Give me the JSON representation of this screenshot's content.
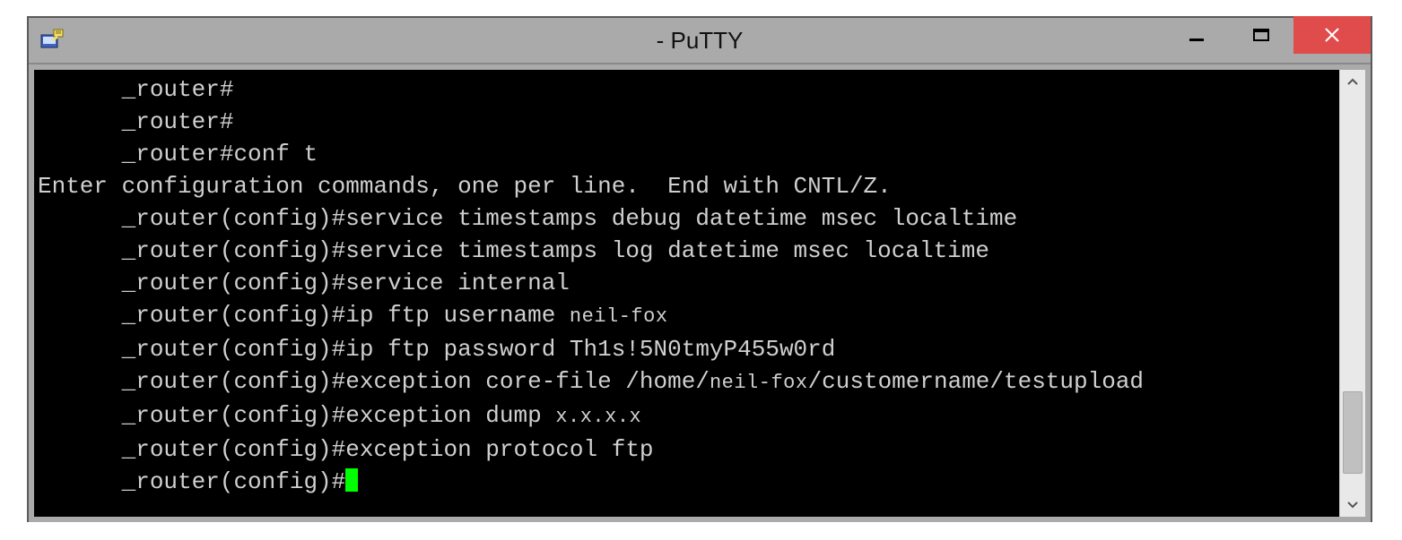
{
  "window": {
    "title": "- PuTTY"
  },
  "terminal": {
    "indent": "      ",
    "lines": {
      "l1": "_router#",
      "l2": "_router#",
      "l3": "_router#conf t",
      "l4": "Enter configuration commands, one per line.  End with CNTL/Z.",
      "l5_prompt": "_router(config)#",
      "l5_cmd": "service timestamps debug datetime msec localtime",
      "l6_prompt": "_router(config)#",
      "l6_cmd": "service timestamps log datetime msec localtime",
      "l7_prompt": "_router(config)#",
      "l7_cmd": "service internal",
      "l8_prompt": "_router(config)#",
      "l8_cmd_a": "ip ftp username ",
      "l8_cmd_b": "neil-fox",
      "l9_prompt": "_router(config)#",
      "l9_cmd": "ip ftp password Th1s!5N0tmyP455w0rd",
      "l10_prompt": "_router(config)#",
      "l10_cmd_a": "exception core-file /home/",
      "l10_cmd_b": "neil-fox",
      "l10_cmd_c": "/customername/testupload",
      "l11_prompt": "_router(config)#",
      "l11_cmd_a": "exception dump ",
      "l11_cmd_b": "x.x.x.x",
      "l12_prompt": "_router(config)#",
      "l12_cmd": "exception protocol ftp",
      "l13_prompt": "_router(config)#"
    }
  }
}
